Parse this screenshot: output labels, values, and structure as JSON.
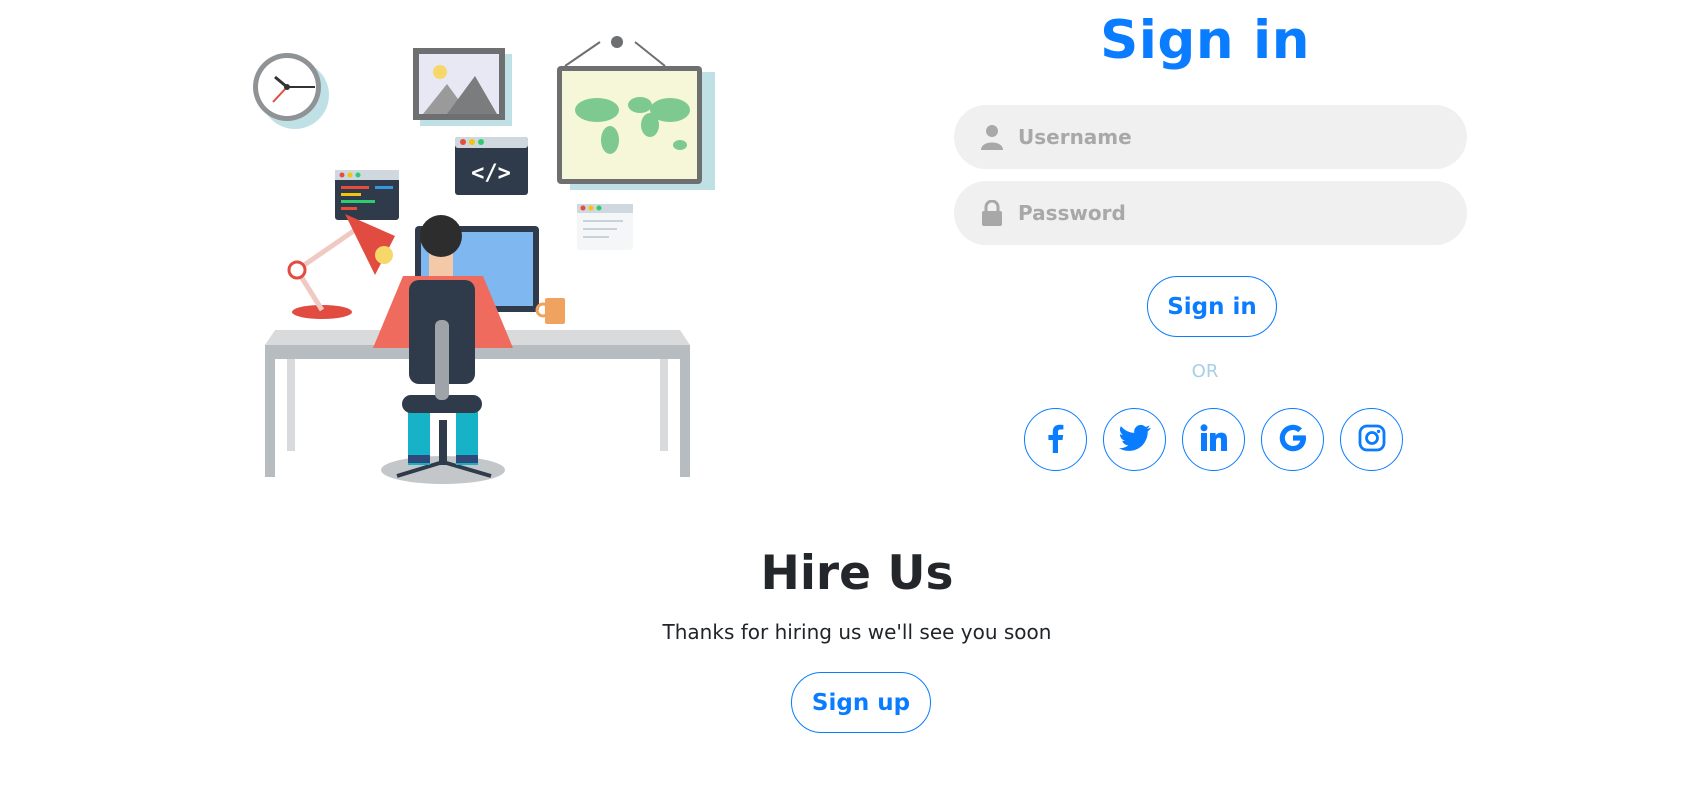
{
  "signin": {
    "title": "Sign in",
    "username_placeholder": "Username",
    "password_placeholder": "Password",
    "button_label": "Sign in",
    "or_text": "OR",
    "social_icons": [
      "facebook-icon",
      "twitter-icon",
      "linkedin-icon",
      "google-icon",
      "instagram-icon"
    ]
  },
  "hire": {
    "title": "Hire Us",
    "text": "Thanks for hiring us we'll see you soon",
    "button_label": "Sign up"
  },
  "colors": {
    "accent": "#0a7cff",
    "field_bg": "#f0f0f0",
    "or_text": "#a7cfe6",
    "heading_dark": "#23272b"
  }
}
